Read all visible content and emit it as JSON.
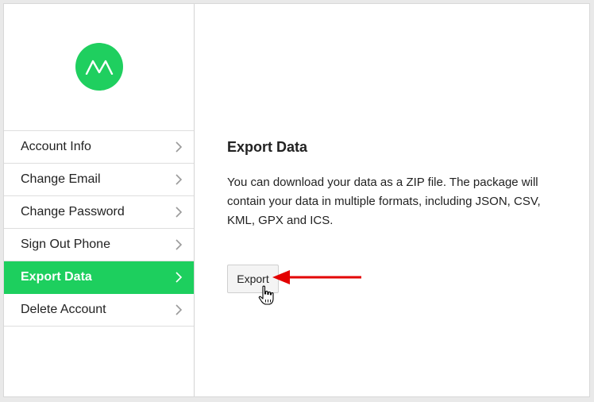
{
  "logo": {
    "icon": "moves-logo-icon",
    "color": "#1fcf5f"
  },
  "sidebar": {
    "items": [
      {
        "label": "Account Info",
        "active": false
      },
      {
        "label": "Change Email",
        "active": false
      },
      {
        "label": "Change Password",
        "active": false
      },
      {
        "label": "Sign Out Phone",
        "active": false
      },
      {
        "label": "Export Data",
        "active": true
      },
      {
        "label": "Delete Account",
        "active": false
      }
    ],
    "item_icon": "chevron-right-icon",
    "active_color": "#1dcf5e"
  },
  "main": {
    "title": "Export Data",
    "description": "You can download your data as a ZIP file. The package will contain your data in multiple formats, including JSON, CSV, KML, GPX and ICS.",
    "export_label": "Export"
  },
  "annotation": {
    "icon": "red-arrow-icon",
    "color": "#e30000"
  },
  "pointer": {
    "icon": "hand-cursor-icon"
  }
}
